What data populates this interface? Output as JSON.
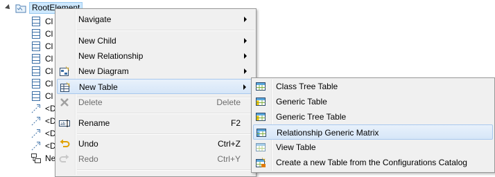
{
  "tree": {
    "root_label": "RootElement",
    "items": [
      {
        "label": "Cl",
        "icon": "class-icon"
      },
      {
        "label": "Cl",
        "icon": "class-icon"
      },
      {
        "label": "Cl",
        "icon": "class-icon"
      },
      {
        "label": "Cl",
        "icon": "class-icon"
      },
      {
        "label": "Cl",
        "icon": "class-icon"
      },
      {
        "label": "Cl",
        "icon": "class-icon"
      },
      {
        "label": "Cl",
        "icon": "class-icon"
      },
      {
        "label": "<D",
        "icon": "relationship-icon"
      },
      {
        "label": "<D",
        "icon": "relationship-icon"
      },
      {
        "label": "<D",
        "icon": "relationship-icon"
      },
      {
        "label": "<D",
        "icon": "relationship-icon"
      },
      {
        "label": "Ne",
        "icon": "nested-element-icon"
      }
    ]
  },
  "context_menu": {
    "navigate": "Navigate",
    "new_child": "New Child",
    "new_relationship": "New Relationship",
    "new_diagram": "New Diagram",
    "new_table": "New Table",
    "delete": "Delete",
    "delete_shortcut": "Delete",
    "rename": "Rename",
    "rename_shortcut": "F2",
    "undo": "Undo",
    "undo_shortcut": "Ctrl+Z",
    "redo": "Redo",
    "redo_shortcut": "Ctrl+Y"
  },
  "submenu": {
    "class_tree_table": "Class Tree Table",
    "generic_table": "Generic Table",
    "generic_tree_table": "Generic Tree Table",
    "relationship_generic_matrix": "Relationship Generic Matrix",
    "view_table": "View Table",
    "configurations_catalog": "Create a new Table from the Configurations Catalog"
  },
  "colors": {
    "menu_background": "#f0f0f0",
    "highlight": "#d6e6f8",
    "highlight_border": "#a8c8ee",
    "selection": "#cde8ff",
    "disabled_text": "#6d6d6d"
  }
}
